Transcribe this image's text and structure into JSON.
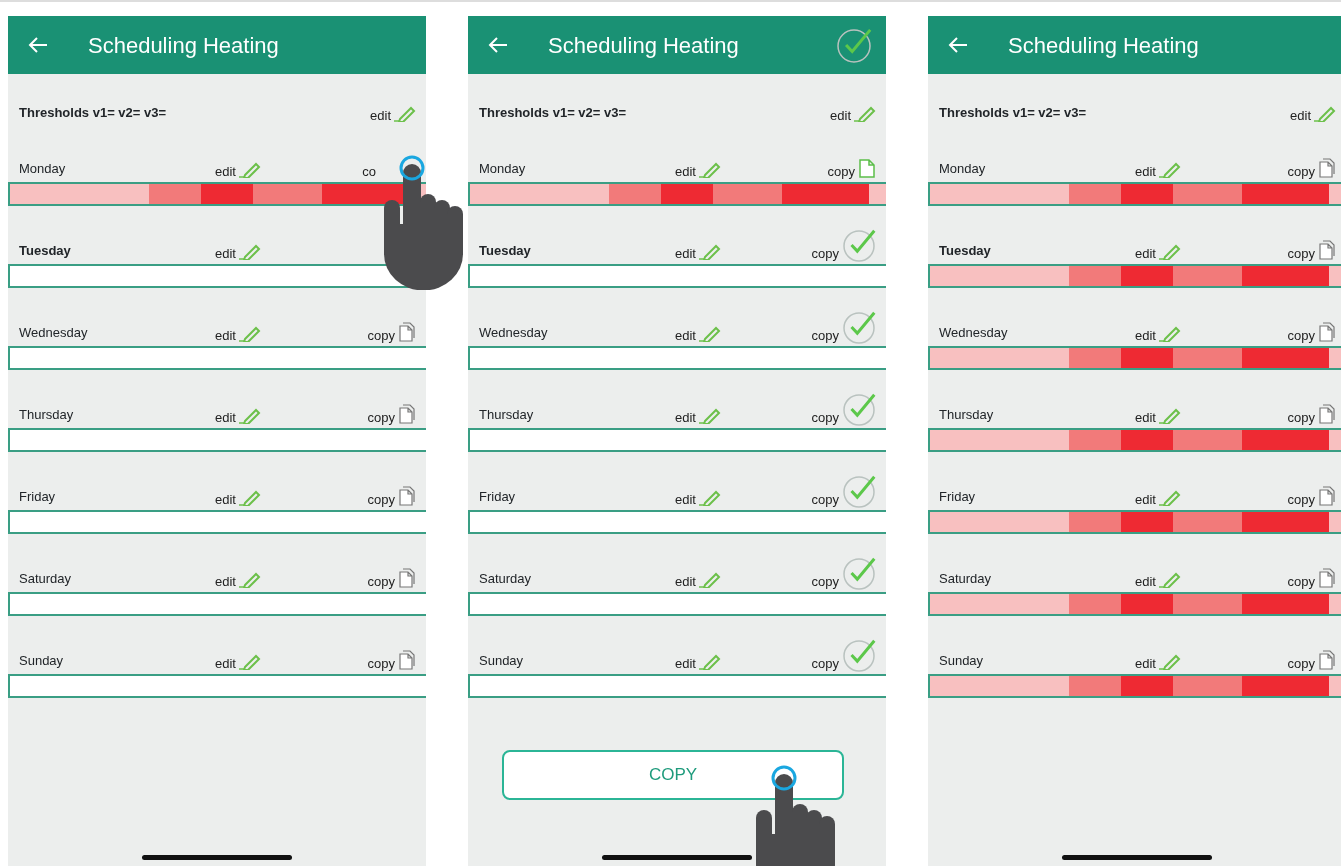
{
  "screens": [
    {
      "title": "Scheduling Heating",
      "confirm": false,
      "thresholds": {
        "label": "Thresholds v1= v2= v3=",
        "edit": "edit"
      },
      "days": [
        {
          "name": "Monday",
          "bold": false,
          "edit": "edit",
          "copy": {
            "label": "co"
          },
          "tapped": true,
          "schedule": [
            {
              "color": "#f8c0c0"
            },
            {
              "color": "#f8c0c0"
            },
            {
              "color": "#f8c0c0"
            },
            {
              "color": "#f8c0c0"
            },
            {
              "color": "#f8c0c0"
            },
            {
              "color": "#f8c0c0"
            },
            {
              "color": "#f8c0c0"
            },
            {
              "color": "#f8c0c0"
            },
            {
              "color": "#f27a7a"
            },
            {
              "color": "#f27a7a"
            },
            {
              "color": "#f27a7a"
            },
            {
              "color": "#ee2a33"
            },
            {
              "color": "#ee2a33"
            },
            {
              "color": "#ee2a33"
            },
            {
              "color": "#f27a7a"
            },
            {
              "color": "#f27a7a"
            },
            {
              "color": "#f27a7a"
            },
            {
              "color": "#f27a7a"
            },
            {
              "color": "#ee2a33"
            },
            {
              "color": "#ee2a33"
            },
            {
              "color": "#ee2a33"
            },
            {
              "color": "#ee2a33"
            },
            {
              "color": "#ee2a33"
            },
            {
              "color": "#f8c0c0"
            }
          ]
        },
        {
          "name": "Tuesday",
          "bold": true,
          "edit": "edit",
          "tapped": false
        },
        {
          "name": "Wednesday",
          "bold": false,
          "edit": "edit",
          "copy": {
            "label": "copy",
            "kind": "documents"
          },
          "tapped": false
        },
        {
          "name": "Thursday",
          "bold": false,
          "edit": "edit",
          "copy": {
            "label": "copy",
            "kind": "documents"
          },
          "tapped": false
        },
        {
          "name": "Friday",
          "bold": false,
          "edit": "edit",
          "copy": {
            "label": "copy",
            "kind": "documents"
          },
          "tapped": false
        },
        {
          "name": "Saturday",
          "bold": false,
          "edit": "edit",
          "copy": {
            "label": "copy",
            "kind": "documents"
          },
          "tapped": false
        },
        {
          "name": "Sunday",
          "bold": false,
          "edit": "edit",
          "copy": {
            "label": "copy",
            "kind": "documents"
          },
          "tapped": false
        }
      ]
    },
    {
      "title": "Scheduling Heating",
      "confirm": true,
      "thresholds": {
        "label": "Thresholds v1= v2= v3=",
        "edit": "edit"
      },
      "days": [
        {
          "name": "Monday",
          "bold": false,
          "edit": "edit",
          "copy": {
            "label": "copy",
            "kind": "source"
          },
          "tapped": false,
          "schedule": [
            {
              "color": "#f8c0c0"
            },
            {
              "color": "#f8c0c0"
            },
            {
              "color": "#f8c0c0"
            },
            {
              "color": "#f8c0c0"
            },
            {
              "color": "#f8c0c0"
            },
            {
              "color": "#f8c0c0"
            },
            {
              "color": "#f8c0c0"
            },
            {
              "color": "#f8c0c0"
            },
            {
              "color": "#f27a7a"
            },
            {
              "color": "#f27a7a"
            },
            {
              "color": "#f27a7a"
            },
            {
              "color": "#ee2a33"
            },
            {
              "color": "#ee2a33"
            },
            {
              "color": "#ee2a33"
            },
            {
              "color": "#f27a7a"
            },
            {
              "color": "#f27a7a"
            },
            {
              "color": "#f27a7a"
            },
            {
              "color": "#f27a7a"
            },
            {
              "color": "#ee2a33"
            },
            {
              "color": "#ee2a33"
            },
            {
              "color": "#ee2a33"
            },
            {
              "color": "#ee2a33"
            },
            {
              "color": "#ee2a33"
            },
            {
              "color": "#f8c0c0"
            }
          ]
        },
        {
          "name": "Tuesday",
          "bold": true,
          "edit": "edit",
          "copy": {
            "label": "copy",
            "kind": "checked"
          },
          "tapped": false
        },
        {
          "name": "Wednesday",
          "bold": false,
          "edit": "edit",
          "copy": {
            "label": "copy",
            "kind": "checked"
          },
          "tapped": false
        },
        {
          "name": "Thursday",
          "bold": false,
          "edit": "edit",
          "copy": {
            "label": "copy",
            "kind": "checked"
          },
          "tapped": false
        },
        {
          "name": "Friday",
          "bold": false,
          "edit": "edit",
          "copy": {
            "label": "copy",
            "kind": "checked"
          },
          "tapped": false
        },
        {
          "name": "Saturday",
          "bold": false,
          "edit": "edit",
          "copy": {
            "label": "copy",
            "kind": "checked"
          },
          "tapped": false
        },
        {
          "name": "Sunday",
          "bold": false,
          "edit": "edit",
          "copy": {
            "label": "copy",
            "kind": "checked"
          },
          "tapped": false
        }
      ],
      "copy_button": {
        "label": "COPY",
        "tapped": true
      }
    },
    {
      "title": "Scheduling Heating",
      "confirm": false,
      "thresholds": {
        "label": "Thresholds v1= v2= v3=",
        "edit": "edit"
      },
      "days": [
        {
          "name": "Monday",
          "bold": false,
          "edit": "edit",
          "copy": {
            "label": "copy",
            "kind": "documents"
          },
          "tapped": false,
          "schedule": [
            {
              "color": "#f8c0c0"
            },
            {
              "color": "#f8c0c0"
            },
            {
              "color": "#f8c0c0"
            },
            {
              "color": "#f8c0c0"
            },
            {
              "color": "#f8c0c0"
            },
            {
              "color": "#f8c0c0"
            },
            {
              "color": "#f8c0c0"
            },
            {
              "color": "#f8c0c0"
            },
            {
              "color": "#f27a7a"
            },
            {
              "color": "#f27a7a"
            },
            {
              "color": "#f27a7a"
            },
            {
              "color": "#ee2a33"
            },
            {
              "color": "#ee2a33"
            },
            {
              "color": "#ee2a33"
            },
            {
              "color": "#f27a7a"
            },
            {
              "color": "#f27a7a"
            },
            {
              "color": "#f27a7a"
            },
            {
              "color": "#f27a7a"
            },
            {
              "color": "#ee2a33"
            },
            {
              "color": "#ee2a33"
            },
            {
              "color": "#ee2a33"
            },
            {
              "color": "#ee2a33"
            },
            {
              "color": "#ee2a33"
            },
            {
              "color": "#f8c0c0"
            }
          ]
        },
        {
          "name": "Tuesday",
          "bold": true,
          "edit": "edit",
          "copy": {
            "label": "copy",
            "kind": "documents"
          },
          "tapped": false,
          "schedule": [
            {
              "color": "#f8c0c0"
            },
            {
              "color": "#f8c0c0"
            },
            {
              "color": "#f8c0c0"
            },
            {
              "color": "#f8c0c0"
            },
            {
              "color": "#f8c0c0"
            },
            {
              "color": "#f8c0c0"
            },
            {
              "color": "#f8c0c0"
            },
            {
              "color": "#f8c0c0"
            },
            {
              "color": "#f27a7a"
            },
            {
              "color": "#f27a7a"
            },
            {
              "color": "#f27a7a"
            },
            {
              "color": "#ee2a33"
            },
            {
              "color": "#ee2a33"
            },
            {
              "color": "#ee2a33"
            },
            {
              "color": "#f27a7a"
            },
            {
              "color": "#f27a7a"
            },
            {
              "color": "#f27a7a"
            },
            {
              "color": "#f27a7a"
            },
            {
              "color": "#ee2a33"
            },
            {
              "color": "#ee2a33"
            },
            {
              "color": "#ee2a33"
            },
            {
              "color": "#ee2a33"
            },
            {
              "color": "#ee2a33"
            },
            {
              "color": "#f8c0c0"
            }
          ]
        },
        {
          "name": "Wednesday",
          "bold": false,
          "edit": "edit",
          "copy": {
            "label": "copy",
            "kind": "documents"
          },
          "tapped": false,
          "schedule": [
            {
              "color": "#f8c0c0"
            },
            {
              "color": "#f8c0c0"
            },
            {
              "color": "#f8c0c0"
            },
            {
              "color": "#f8c0c0"
            },
            {
              "color": "#f8c0c0"
            },
            {
              "color": "#f8c0c0"
            },
            {
              "color": "#f8c0c0"
            },
            {
              "color": "#f8c0c0"
            },
            {
              "color": "#f27a7a"
            },
            {
              "color": "#f27a7a"
            },
            {
              "color": "#f27a7a"
            },
            {
              "color": "#ee2a33"
            },
            {
              "color": "#ee2a33"
            },
            {
              "color": "#ee2a33"
            },
            {
              "color": "#f27a7a"
            },
            {
              "color": "#f27a7a"
            },
            {
              "color": "#f27a7a"
            },
            {
              "color": "#f27a7a"
            },
            {
              "color": "#ee2a33"
            },
            {
              "color": "#ee2a33"
            },
            {
              "color": "#ee2a33"
            },
            {
              "color": "#ee2a33"
            },
            {
              "color": "#ee2a33"
            },
            {
              "color": "#f8c0c0"
            }
          ]
        },
        {
          "name": "Thursday",
          "bold": false,
          "edit": "edit",
          "copy": {
            "label": "copy",
            "kind": "documents"
          },
          "tapped": false,
          "schedule": [
            {
              "color": "#f8c0c0"
            },
            {
              "color": "#f8c0c0"
            },
            {
              "color": "#f8c0c0"
            },
            {
              "color": "#f8c0c0"
            },
            {
              "color": "#f8c0c0"
            },
            {
              "color": "#f8c0c0"
            },
            {
              "color": "#f8c0c0"
            },
            {
              "color": "#f8c0c0"
            },
            {
              "color": "#f27a7a"
            },
            {
              "color": "#f27a7a"
            },
            {
              "color": "#f27a7a"
            },
            {
              "color": "#ee2a33"
            },
            {
              "color": "#ee2a33"
            },
            {
              "color": "#ee2a33"
            },
            {
              "color": "#f27a7a"
            },
            {
              "color": "#f27a7a"
            },
            {
              "color": "#f27a7a"
            },
            {
              "color": "#f27a7a"
            },
            {
              "color": "#ee2a33"
            },
            {
              "color": "#ee2a33"
            },
            {
              "color": "#ee2a33"
            },
            {
              "color": "#ee2a33"
            },
            {
              "color": "#ee2a33"
            },
            {
              "color": "#f8c0c0"
            }
          ]
        },
        {
          "name": "Friday",
          "bold": false,
          "edit": "edit",
          "copy": {
            "label": "copy",
            "kind": "documents"
          },
          "tapped": false,
          "schedule": [
            {
              "color": "#f8c0c0"
            },
            {
              "color": "#f8c0c0"
            },
            {
              "color": "#f8c0c0"
            },
            {
              "color": "#f8c0c0"
            },
            {
              "color": "#f8c0c0"
            },
            {
              "color": "#f8c0c0"
            },
            {
              "color": "#f8c0c0"
            },
            {
              "color": "#f8c0c0"
            },
            {
              "color": "#f27a7a"
            },
            {
              "color": "#f27a7a"
            },
            {
              "color": "#f27a7a"
            },
            {
              "color": "#ee2a33"
            },
            {
              "color": "#ee2a33"
            },
            {
              "color": "#ee2a33"
            },
            {
              "color": "#f27a7a"
            },
            {
              "color": "#f27a7a"
            },
            {
              "color": "#f27a7a"
            },
            {
              "color": "#f27a7a"
            },
            {
              "color": "#ee2a33"
            },
            {
              "color": "#ee2a33"
            },
            {
              "color": "#ee2a33"
            },
            {
              "color": "#ee2a33"
            },
            {
              "color": "#ee2a33"
            },
            {
              "color": "#f8c0c0"
            }
          ]
        },
        {
          "name": "Saturday",
          "bold": false,
          "edit": "edit",
          "copy": {
            "label": "copy",
            "kind": "documents"
          },
          "tapped": false,
          "schedule": [
            {
              "color": "#f8c0c0"
            },
            {
              "color": "#f8c0c0"
            },
            {
              "color": "#f8c0c0"
            },
            {
              "color": "#f8c0c0"
            },
            {
              "color": "#f8c0c0"
            },
            {
              "color": "#f8c0c0"
            },
            {
              "color": "#f8c0c0"
            },
            {
              "color": "#f8c0c0"
            },
            {
              "color": "#f27a7a"
            },
            {
              "color": "#f27a7a"
            },
            {
              "color": "#f27a7a"
            },
            {
              "color": "#ee2a33"
            },
            {
              "color": "#ee2a33"
            },
            {
              "color": "#ee2a33"
            },
            {
              "color": "#f27a7a"
            },
            {
              "color": "#f27a7a"
            },
            {
              "color": "#f27a7a"
            },
            {
              "color": "#f27a7a"
            },
            {
              "color": "#ee2a33"
            },
            {
              "color": "#ee2a33"
            },
            {
              "color": "#ee2a33"
            },
            {
              "color": "#ee2a33"
            },
            {
              "color": "#ee2a33"
            },
            {
              "color": "#f8c0c0"
            }
          ]
        },
        {
          "name": "Sunday",
          "bold": false,
          "edit": "edit",
          "copy": {
            "label": "copy",
            "kind": "documents"
          },
          "tapped": false,
          "schedule": [
            {
              "color": "#f8c0c0"
            },
            {
              "color": "#f8c0c0"
            },
            {
              "color": "#f8c0c0"
            },
            {
              "color": "#f8c0c0"
            },
            {
              "color": "#f8c0c0"
            },
            {
              "color": "#f8c0c0"
            },
            {
              "color": "#f8c0c0"
            },
            {
              "color": "#f8c0c0"
            },
            {
              "color": "#f27a7a"
            },
            {
              "color": "#f27a7a"
            },
            {
              "color": "#f27a7a"
            },
            {
              "color": "#ee2a33"
            },
            {
              "color": "#ee2a33"
            },
            {
              "color": "#ee2a33"
            },
            {
              "color": "#f27a7a"
            },
            {
              "color": "#f27a7a"
            },
            {
              "color": "#f27a7a"
            },
            {
              "color": "#f27a7a"
            },
            {
              "color": "#ee2a33"
            },
            {
              "color": "#ee2a33"
            },
            {
              "color": "#ee2a33"
            },
            {
              "color": "#ee2a33"
            },
            {
              "color": "#ee2a33"
            },
            {
              "color": "#f8c0c0"
            }
          ]
        }
      ]
    }
  ]
}
